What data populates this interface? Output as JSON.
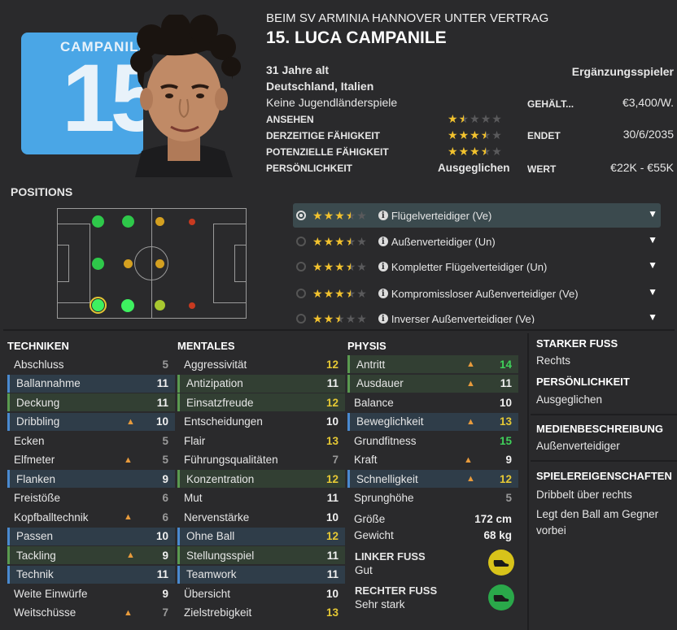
{
  "header": {
    "club_line": "BEIM SV ARMINIA HANNOVER UNTER VERTRAG",
    "player_name": "15. LUCA CAMPANILE",
    "shirt_name": "CAMPANILE",
    "shirt_number": "15",
    "age": "31 Jahre alt",
    "nationality": "Deutschland, Italien",
    "youth_caps": "Keine Jugendländerspiele",
    "squad_status": "Ergänzungsspieler"
  },
  "ratings": [
    {
      "label": "ANSEHEN",
      "stars": 1.5
    },
    {
      "label": "DERZEITIGE FÄHIGKEIT",
      "stars": 3.5
    },
    {
      "label": "POTENZIELLE FÄHIGKEIT",
      "stars": 3.5
    },
    {
      "label": "PERSÖNLICHKEIT",
      "value": "Ausgeglichen"
    }
  ],
  "contract": [
    {
      "label": "GEHÄLT...",
      "value": "€3,400/W."
    },
    {
      "label": "ENDET",
      "value": "30/6/2035"
    },
    {
      "label": "WERT",
      "value": "€22K - €55K"
    }
  ],
  "positions": {
    "title": "POSITIONS",
    "roles": [
      {
        "label": "Flügelverteidiger (Ve)",
        "stars": 3.5,
        "selected": true
      },
      {
        "label": "Außenverteidiger (Un)",
        "stars": 3.5,
        "selected": false
      },
      {
        "label": "Kompletter Flügelverteidiger (Un)",
        "stars": 3.5,
        "selected": false
      },
      {
        "label": "Kompromissloser Außenverteidiger (Ve)",
        "stars": 3.5,
        "selected": false
      },
      {
        "label": "Inverser Außenverteidiger (Ve)",
        "stars": 2.5,
        "selected": false
      }
    ]
  },
  "colors": {
    "grey": "#9a9a9a",
    "white": "#f0f0f0",
    "yellow": "#e5c834",
    "green": "#3fd05a",
    "accent_blue": "#4a8ad0",
    "accent_green": "#5a9a50",
    "shirt": "#4aa6e6"
  },
  "techniken": {
    "title": "TECHNIKEN",
    "items": [
      {
        "name": "Abschluss",
        "value": "5",
        "color": "grey",
        "hl": "",
        "arrow": false
      },
      {
        "name": "Ballannahme",
        "value": "11",
        "color": "white",
        "hl": "b",
        "arrow": false
      },
      {
        "name": "Deckung",
        "value": "11",
        "color": "white",
        "hl": "g",
        "arrow": false
      },
      {
        "name": "Dribbling",
        "value": "10",
        "color": "white",
        "hl": "b",
        "arrow": true
      },
      {
        "name": "Ecken",
        "value": "5",
        "color": "grey",
        "hl": "",
        "arrow": false
      },
      {
        "name": "Elfmeter",
        "value": "5",
        "color": "grey",
        "hl": "",
        "arrow": true
      },
      {
        "name": "Flanken",
        "value": "9",
        "color": "white",
        "hl": "b",
        "arrow": false
      },
      {
        "name": "Freistöße",
        "value": "6",
        "color": "grey",
        "hl": "",
        "arrow": false
      },
      {
        "name": "Kopfballtechnik",
        "value": "6",
        "color": "grey",
        "hl": "",
        "arrow": true
      },
      {
        "name": "Passen",
        "value": "10",
        "color": "white",
        "hl": "b",
        "arrow": false
      },
      {
        "name": "Tackling",
        "value": "9",
        "color": "white",
        "hl": "g",
        "arrow": true
      },
      {
        "name": "Technik",
        "value": "11",
        "color": "white",
        "hl": "b",
        "arrow": false
      },
      {
        "name": "Weite Einwürfe",
        "value": "9",
        "color": "white",
        "hl": "",
        "arrow": false
      },
      {
        "name": "Weitschüsse",
        "value": "7",
        "color": "grey",
        "hl": "",
        "arrow": true
      }
    ]
  },
  "mentales": {
    "title": "MENTALES",
    "items": [
      {
        "name": "Aggressivität",
        "value": "12",
        "color": "yellow",
        "hl": "",
        "arrow": false
      },
      {
        "name": "Antizipation",
        "value": "11",
        "color": "white",
        "hl": "g",
        "arrow": false
      },
      {
        "name": "Einsatzfreude",
        "value": "12",
        "color": "yellow",
        "hl": "g",
        "arrow": false
      },
      {
        "name": "Entscheidungen",
        "value": "10",
        "color": "white",
        "hl": "",
        "arrow": false
      },
      {
        "name": "Flair",
        "value": "13",
        "color": "yellow",
        "hl": "",
        "arrow": false
      },
      {
        "name": "Führungsqualitäten",
        "value": "7",
        "color": "grey",
        "hl": "",
        "arrow": false
      },
      {
        "name": "Konzentration",
        "value": "12",
        "color": "yellow",
        "hl": "g",
        "arrow": false
      },
      {
        "name": "Mut",
        "value": "11",
        "color": "white",
        "hl": "",
        "arrow": false
      },
      {
        "name": "Nervenstärke",
        "value": "10",
        "color": "white",
        "hl": "",
        "arrow": false
      },
      {
        "name": "Ohne Ball",
        "value": "12",
        "color": "yellow",
        "hl": "b",
        "arrow": false
      },
      {
        "name": "Stellungsspiel",
        "value": "11",
        "color": "white",
        "hl": "g",
        "arrow": false
      },
      {
        "name": "Teamwork",
        "value": "11",
        "color": "white",
        "hl": "b",
        "arrow": false
      },
      {
        "name": "Übersicht",
        "value": "10",
        "color": "white",
        "hl": "",
        "arrow": false
      },
      {
        "name": "Zielstrebigkeit",
        "value": "13",
        "color": "yellow",
        "hl": "",
        "arrow": false
      }
    ]
  },
  "physis": {
    "title": "PHYSIS",
    "items": [
      {
        "name": "Antritt",
        "value": "14",
        "color": "green",
        "hl": "g",
        "arrow": true
      },
      {
        "name": "Ausdauer",
        "value": "11",
        "color": "white",
        "hl": "g",
        "arrow": true
      },
      {
        "name": "Balance",
        "value": "10",
        "color": "white",
        "hl": "",
        "arrow": false
      },
      {
        "name": "Beweglichkeit",
        "value": "13",
        "color": "yellow",
        "hl": "b",
        "arrow": true
      },
      {
        "name": "Grundfitness",
        "value": "15",
        "color": "green",
        "hl": "",
        "arrow": false
      },
      {
        "name": "Kraft",
        "value": "9",
        "color": "white",
        "hl": "",
        "arrow": true
      },
      {
        "name": "Schnelligkeit",
        "value": "12",
        "color": "yellow",
        "hl": "b",
        "arrow": true
      },
      {
        "name": "Sprunghöhe",
        "value": "5",
        "color": "grey",
        "hl": "",
        "arrow": false
      }
    ],
    "size_label": "Größe",
    "size_value": "172 cm",
    "weight_label": "Gewicht",
    "weight_value": "68 kg",
    "left_foot_title": "LINKER FUSS",
    "left_foot_value": "Gut",
    "right_foot_title": "RECHTER FUSS",
    "right_foot_value": "Sehr stark"
  },
  "side": {
    "strong_foot_title": "STARKER FUSS",
    "strong_foot_value": "Rechts",
    "personality_title": "PERSÖNLICHKEIT",
    "personality_value": "Ausgeglichen",
    "media_title": "MEDIENBESCHREIBUNG",
    "media_value": "Außenverteidiger",
    "traits_title": "SPIELEREIGENSCHAFTEN",
    "traits": [
      "Dribbelt über rechts",
      "Legt den Ball am Gegner vorbei"
    ]
  }
}
